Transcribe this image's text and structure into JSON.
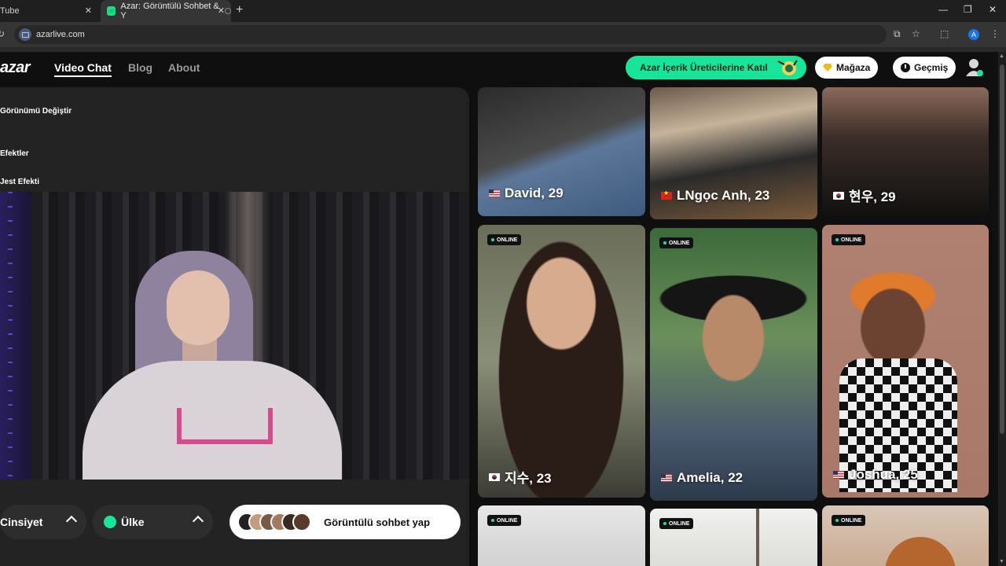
{
  "browser": {
    "tabs": [
      {
        "title": "Tube",
        "close": "✕"
      },
      {
        "title": "Azar: Görüntülü Sohbet & Y",
        "close": "✕"
      }
    ],
    "new_tab": "+",
    "window_controls": {
      "minimize": "—",
      "restore": "❐",
      "close": "✕"
    },
    "url": "azarlive.com",
    "profile_initial": "A"
  },
  "header": {
    "logo": "azar",
    "nav": [
      {
        "label": "Video Chat",
        "active": true
      },
      {
        "label": "Blog",
        "active": false
      },
      {
        "label": "About",
        "active": false
      }
    ],
    "join_button": "Azar İçerik Üreticilerine Katıl",
    "shop_button": "Mağaza",
    "history_button": "Geçmiş"
  },
  "left_panel": {
    "change_view": "Görünümü Değiştir",
    "effects": "Efektler",
    "gesture_effect": "Jest Efekti",
    "gender_filter": "Cinsiyet",
    "country_filter": "Ülke",
    "start_button": "Görüntülü sohbet yap"
  },
  "profiles": [
    {
      "name": "David, 29",
      "flag": "us",
      "online": false
    },
    {
      "name": "LNgọc Anh, 23",
      "flag": "vn",
      "online": false
    },
    {
      "name": "현우, 29",
      "flag": "kr",
      "online": false
    },
    {
      "name": "지수, 23",
      "flag": "kr",
      "online": true
    },
    {
      "name": "Amelia, 22",
      "flag": "us",
      "online": true
    },
    {
      "name": "Joshua, 25",
      "flag": "us",
      "online": true
    },
    {
      "name": "",
      "flag": "",
      "online": true
    },
    {
      "name": "",
      "flag": "",
      "online": true
    },
    {
      "name": "",
      "flag": "",
      "online": true
    }
  ],
  "online_label": "ONLINE",
  "colors": {
    "accent": "#17e59a",
    "panel": "#232323",
    "background": "#0f0f0f"
  }
}
